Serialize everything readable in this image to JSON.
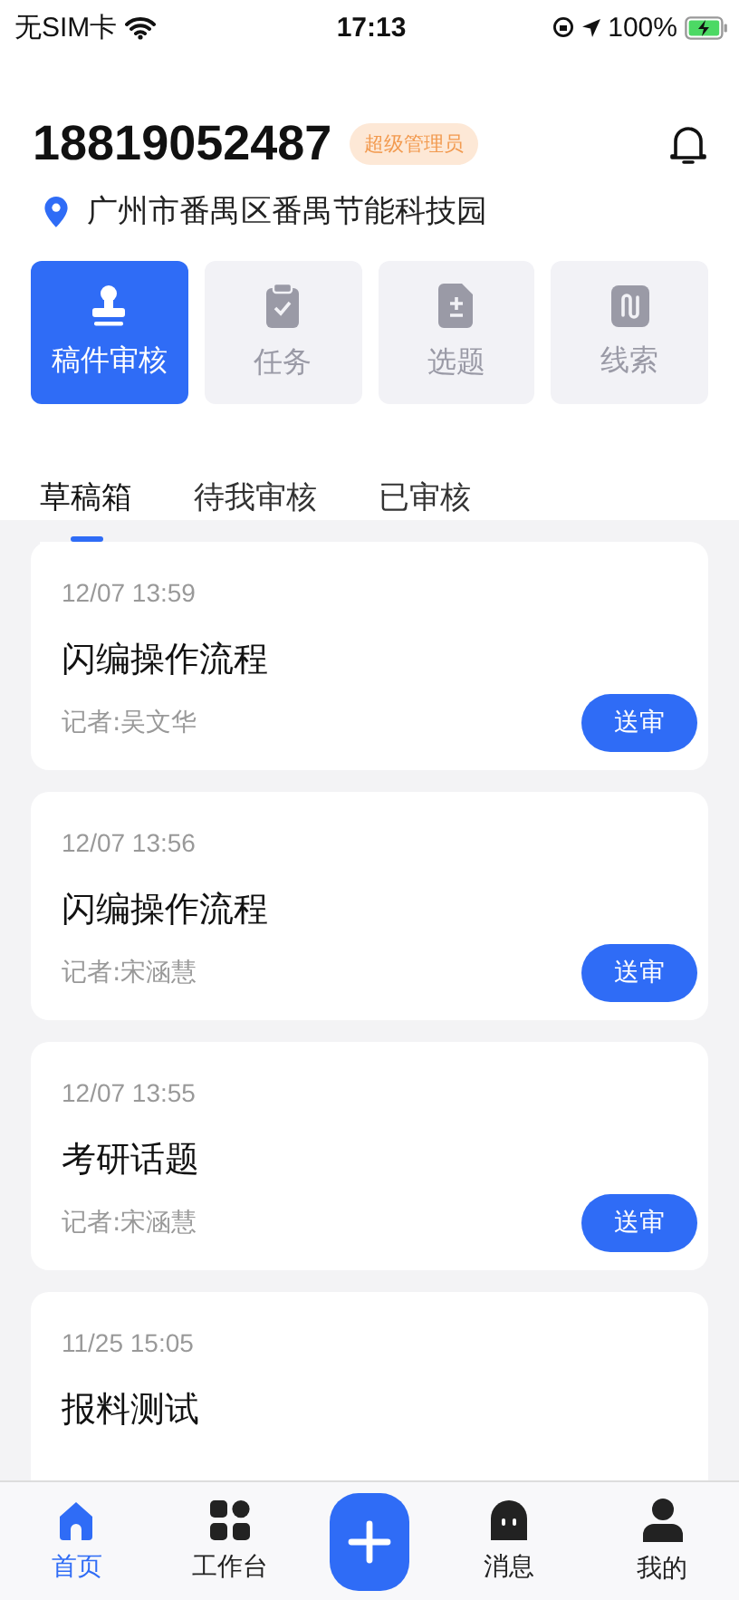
{
  "status_bar": {
    "carrier": "无SIM卡",
    "time": "17:13",
    "battery": "100%"
  },
  "header": {
    "phone": "18819052487",
    "role_badge": "超级管理员",
    "location": "广州市番禺区番禺节能科技园"
  },
  "modules": [
    {
      "label": "稿件审核",
      "selected": true
    },
    {
      "label": "任务",
      "selected": false
    },
    {
      "label": "选题",
      "selected": false
    },
    {
      "label": "线索",
      "selected": false
    }
  ],
  "tabs": [
    {
      "label": "草稿箱",
      "selected": true
    },
    {
      "label": "待我审核",
      "selected": false
    },
    {
      "label": "已审核",
      "selected": false
    }
  ],
  "drafts": [
    {
      "time": "12/07 13:59",
      "title": "闪编操作流程",
      "reporter": "记者:吴文华",
      "action": "送审"
    },
    {
      "time": "12/07 13:56",
      "title": "闪编操作流程",
      "reporter": "记者:宋涵慧",
      "action": "送审"
    },
    {
      "time": "12/07 13:55",
      "title": "考研话题",
      "reporter": "记者:宋涵慧",
      "action": "送审"
    },
    {
      "time": "11/25 15:05",
      "title": "报料测试"
    }
  ],
  "bottom_nav": [
    {
      "kind": "tab",
      "label": "首页",
      "selected": true
    },
    {
      "kind": "tab",
      "label": "工作台",
      "selected": false
    },
    {
      "kind": "add"
    },
    {
      "kind": "tab",
      "label": "消息",
      "selected": false
    },
    {
      "kind": "tab",
      "label": "我的",
      "selected": false
    }
  ]
}
